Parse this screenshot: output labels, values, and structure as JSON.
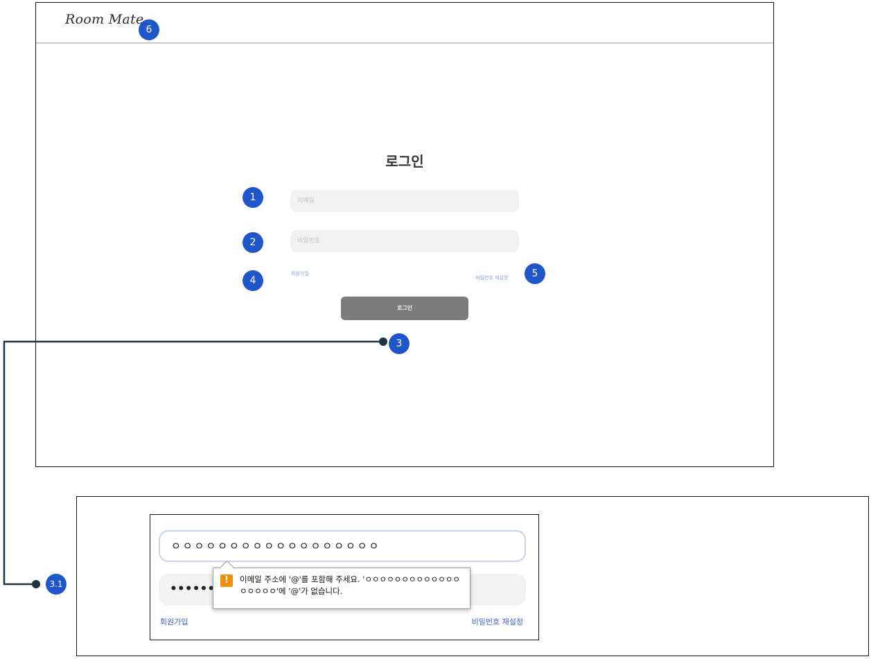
{
  "header": {
    "logo_text": "Room Mate"
  },
  "login": {
    "title": "로그인",
    "email_placeholder": "이메일",
    "password_placeholder": "비밀번호",
    "signup_label": "회원가입",
    "reset_password_label": "비밀번호 재설정",
    "login_button_label": "로그인"
  },
  "callouts": {
    "email": "1",
    "password": "2",
    "login_button": "3",
    "signup": "4",
    "reset_password": "5",
    "logo": "6",
    "validation_detail": "3.1"
  },
  "detail": {
    "email_value": "ㅇㅇㅇㅇㅇㅇㅇㅇㅇㅇㅇㅇㅇㅇㅇㅇㅇㅇ",
    "password_value": "••••••••",
    "tooltip_message": "이메일 주소에 '@'를 포함해 주세요. 'ㅇㅇㅇㅇㅇㅇㅇㅇㅇㅇㅇㅇㅇㅇㅇㅇㅇㅇ'에 '@'가 없습니다.",
    "signup_label": "회원가입",
    "reset_password_label": "비밀번호 재설정"
  },
  "colors": {
    "badge": "#1f56c9",
    "link": "#3b62d1",
    "login_button": "#7c7c7c",
    "warning": "#f0900a",
    "connector": "#1c3346"
  },
  "icons": {
    "tooltip_icon": "warning-icon"
  }
}
